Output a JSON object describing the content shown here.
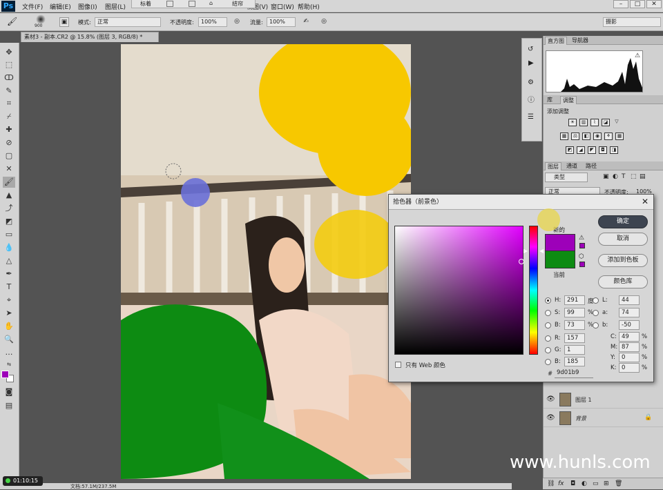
{
  "app": {
    "logo": "Ps"
  },
  "menu": [
    "文件(F)",
    "编辑(E)",
    "图像(I)",
    "图层(L)",
    "视图(V)",
    "窗口(W)",
    "帮助(H)"
  ],
  "floating_bar": {
    "left": "标着",
    "right": "结帘"
  },
  "options": {
    "brush_size": "900",
    "mode_label": "模式:",
    "mode_value": "正常",
    "opacity_label": "不透明度:",
    "opacity_value": "100%",
    "flow_label": "流量:",
    "flow_value": "100%",
    "workspace": "摄影"
  },
  "document_tab": "素材3 - 副本.CR2 @ 15.8% (图层 3, RGB/8) *",
  "histogram_panel": {
    "tabs": [
      "直方图",
      "导航器"
    ]
  },
  "adjust_panel": {
    "tabs": [
      "库",
      "调整"
    ],
    "add_label": "添加调整"
  },
  "layers_panel": {
    "tabs": [
      "图层",
      "通道",
      "路径"
    ],
    "filter": "类型",
    "blend": "正常",
    "opacity_label": "不透明度:",
    "opacity_value": "100%",
    "layers": [
      {
        "name": "图层 1"
      },
      {
        "name": "背景"
      }
    ]
  },
  "color_picker": {
    "title": "拾色器（前景色）",
    "new_label": "新的",
    "current_label": "当前",
    "new_color": "#9d01b9",
    "current_color": "#0d8b12",
    "buttons": [
      "确定",
      "取消",
      "添加到色板",
      "颜色库"
    ],
    "hsb": [
      {
        "label": "H:",
        "value": "291",
        "unit": "度"
      },
      {
        "label": "S:",
        "value": "99",
        "unit": "%"
      },
      {
        "label": "B:",
        "value": "73",
        "unit": "%"
      }
    ],
    "rgb": [
      {
        "label": "R:",
        "value": "157"
      },
      {
        "label": "G:",
        "value": "1"
      },
      {
        "label": "B:",
        "value": "185"
      }
    ],
    "lab": [
      {
        "label": "L:",
        "value": "44"
      },
      {
        "label": "a:",
        "value": "74"
      },
      {
        "label": "b:",
        "value": "-50"
      }
    ],
    "cmyk": [
      {
        "label": "C:",
        "value": "49",
        "unit": "%"
      },
      {
        "label": "M:",
        "value": "87",
        "unit": "%"
      },
      {
        "label": "Y:",
        "value": "0",
        "unit": "%"
      },
      {
        "label": "K:",
        "value": "0",
        "unit": "%"
      }
    ],
    "hex_label": "#",
    "hex": "9d01b9",
    "web_only": "只有 Web 颜色"
  },
  "status": {
    "doc": "文档:57.1M/237.5M"
  },
  "timer": "01:10:15",
  "watermark": "www.hunls.com"
}
